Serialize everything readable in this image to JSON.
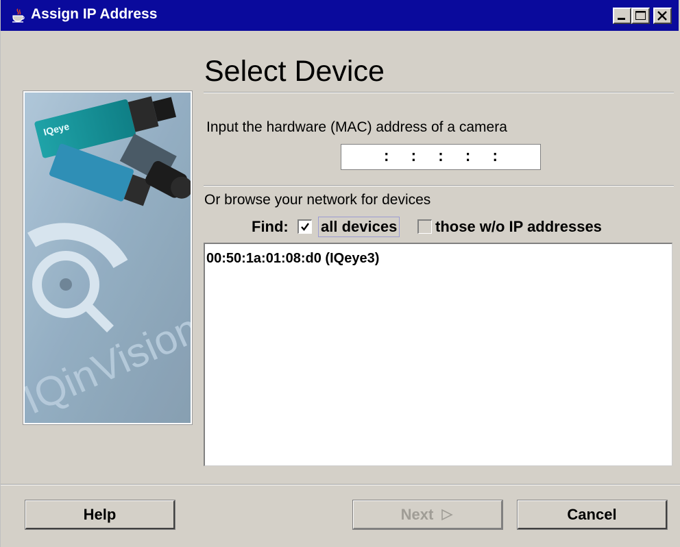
{
  "window": {
    "title": "Assign IP Address",
    "icon": "java-cup-icon",
    "controls": [
      "minimize-icon",
      "maximize-icon",
      "close-icon"
    ]
  },
  "page": {
    "title": "Select Device"
  },
  "mac_section": {
    "label": "Input the hardware (MAC) address of a camera",
    "value": " :  :  :  :  : "
  },
  "browse_section": {
    "label": "Or browse your network for devices",
    "find_label": "Find:",
    "options": [
      {
        "label": "all devices",
        "checked": true
      },
      {
        "label": "those w/o IP addresses",
        "checked": false
      }
    ],
    "devices": [
      "00:50:1a:01:08:d0 (IQeye3)"
    ]
  },
  "image": {
    "brand_text": "IQinVision",
    "camera_label": "IQeye"
  },
  "buttons": {
    "help": "Help",
    "next": "Next",
    "cancel": "Cancel"
  },
  "colors": {
    "titlebar": "#0a0a9c",
    "face": "#d4d0c8",
    "disabled_text": "#a09d96"
  }
}
